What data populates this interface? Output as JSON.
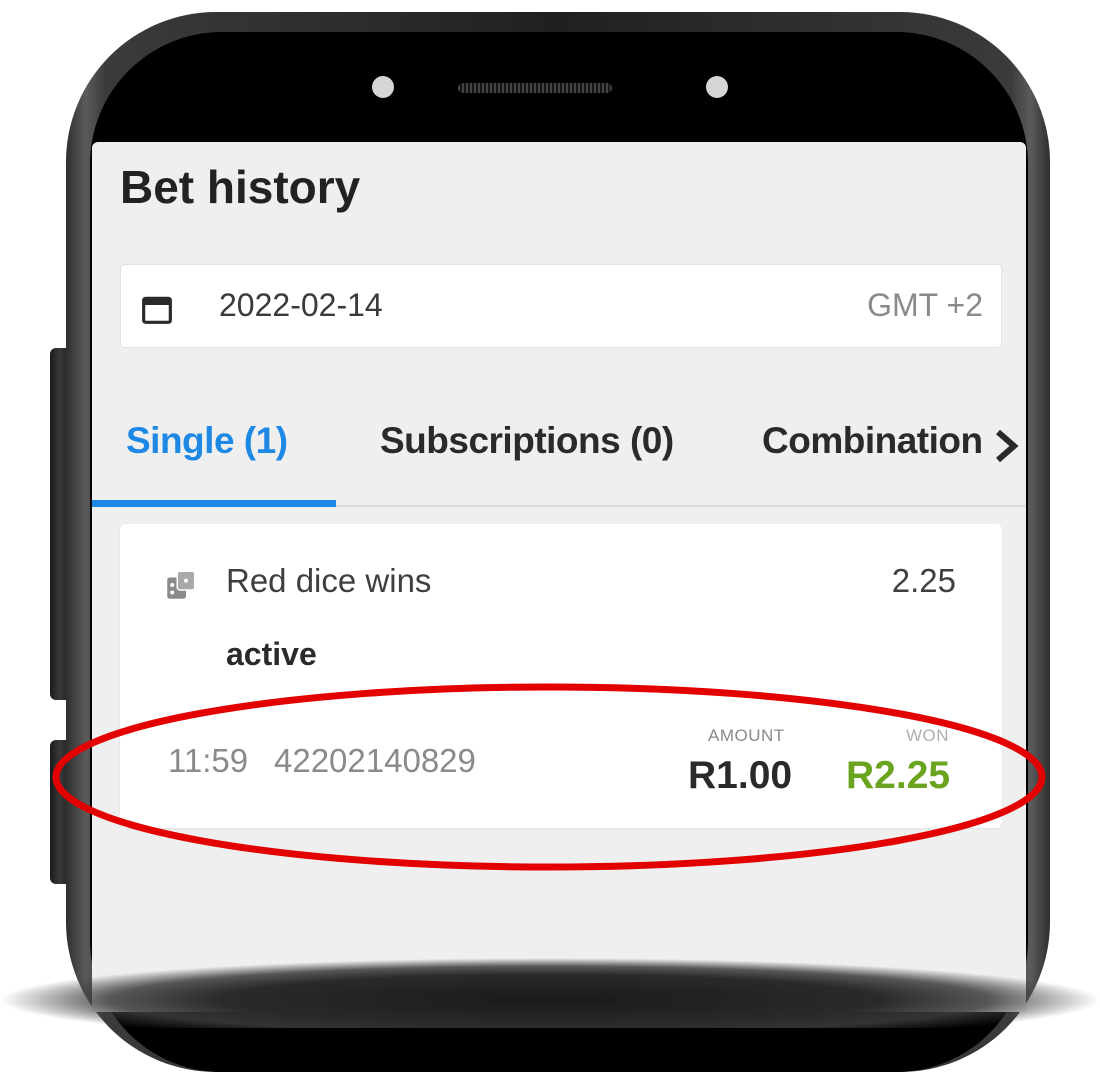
{
  "page": {
    "title": "Bet history"
  },
  "date_filter": {
    "value": "2022-02-14",
    "timezone": "GMT +2",
    "icon": "calendar-icon"
  },
  "tabs": [
    {
      "label": "Single (1)",
      "active": true
    },
    {
      "label": "Subscriptions (0)",
      "active": false
    },
    {
      "label": "Combination",
      "active": false
    }
  ],
  "bet": {
    "icon": "dice-icon",
    "name": "Red dice wins",
    "odds": "2.25",
    "status": "active",
    "time": "11:59",
    "id": "42202140829",
    "amount_label": "AMOUNT",
    "amount": "R1.00",
    "won_label": "WON",
    "won": "R2.25"
  },
  "colors": {
    "accent": "#1e88e5",
    "won": "#6aa31e",
    "highlight": "#e30000",
    "screen_bg": "#efefef"
  }
}
